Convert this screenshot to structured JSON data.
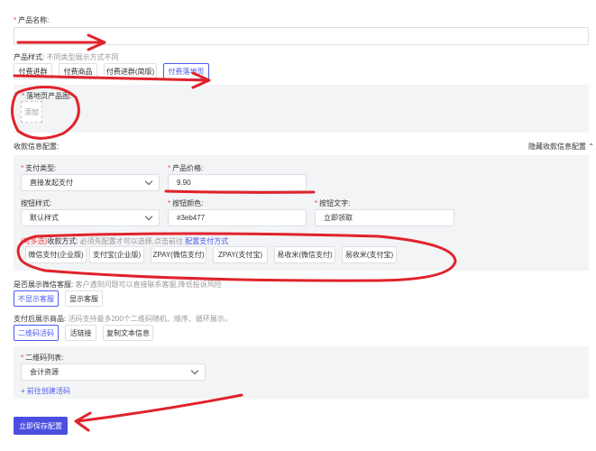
{
  "product_name": {
    "label": "产品名称:",
    "value": ""
  },
  "product_style": {
    "label": "产品样式:",
    "hint": "不同类型展示方式不同",
    "options": [
      "付费进群",
      "付费商品",
      "付费进群(简版)",
      "付费落地页"
    ],
    "selected": 3
  },
  "landing_page": {
    "label": "落地页产品图:",
    "add_label": "添加"
  },
  "payment_section": {
    "title": "收款信息配置:",
    "collapse_label": "隐藏收款信息配置",
    "payment_type": {
      "label": "支付类型:",
      "value": "直接发起支付"
    },
    "price": {
      "label": "产品价格:",
      "value": "9.90"
    },
    "button_style": {
      "label": "按钮样式:",
      "value": "默认样式"
    },
    "button_color": {
      "label": "按钮颜色:",
      "value": "#3eb477"
    },
    "button_text": {
      "label": "按钮文字:",
      "value": "立即领取"
    },
    "methods_label": "收款方式:",
    "methods_multi": "(可多选)",
    "methods_hint": "必须先配置才可以选择,点击前往",
    "methods_link": "配置支付方式",
    "methods": [
      "微信支付(企业版)",
      "支付宝(企业版)",
      "ZPAY(微信支付)",
      "ZPAY(支付宝)",
      "易收米(微信支付)",
      "易收米(支付宝)"
    ]
  },
  "customer_service": {
    "label": "是否展示微信客服:",
    "hint": "客户遇到问题可以直接联系客服,降低投诉风险",
    "options": [
      "不显示客服",
      "显示客服"
    ],
    "selected": 0
  },
  "after_pay": {
    "label": "支付后展示商品:",
    "hint": "活码支持最多200个二维码随机、顺序、循环展示。",
    "options": [
      "二维码活码",
      "活链接",
      "复制文本信息"
    ],
    "selected": 0
  },
  "qrcode": {
    "label": "二维码列表:",
    "value": "会计资源",
    "create_link": "+ 前往创建活码"
  },
  "save_button": "立即保存配置",
  "colors": {
    "accent": "#4a5af0",
    "required": "#e54545",
    "annotation": "#e0232b"
  },
  "icons": {
    "collapse": "double-chevron-up-icon",
    "select": "chevron-down-icon"
  }
}
